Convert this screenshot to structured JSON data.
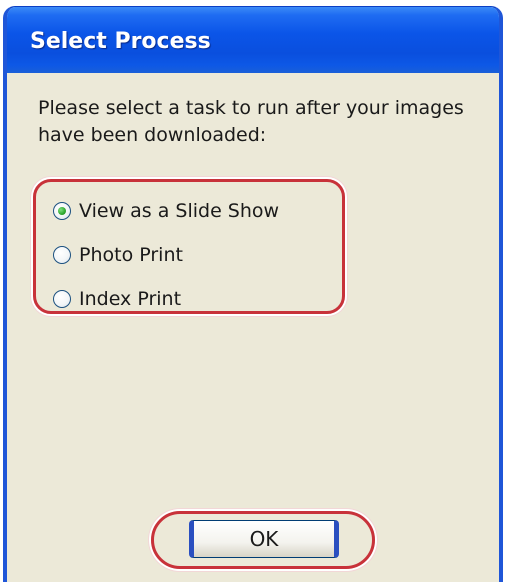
{
  "window": {
    "title": "Select Process"
  },
  "prompt": {
    "line1": "Please select a task to run after your images",
    "line2": "have been downloaded:"
  },
  "options": {
    "selected": "View as a Slide Show",
    "items": [
      {
        "label": "View as a Slide Show",
        "checked": true
      },
      {
        "label": "Photo Print",
        "checked": false
      },
      {
        "label": "Index Print",
        "checked": false
      }
    ]
  },
  "buttons": {
    "ok_label": "OK"
  },
  "colors": {
    "title_bar": "#0b55e8",
    "window_bg": "#ece9d8",
    "highlight_outline": "#c8323a",
    "radio_selected": "#2fa82f"
  }
}
